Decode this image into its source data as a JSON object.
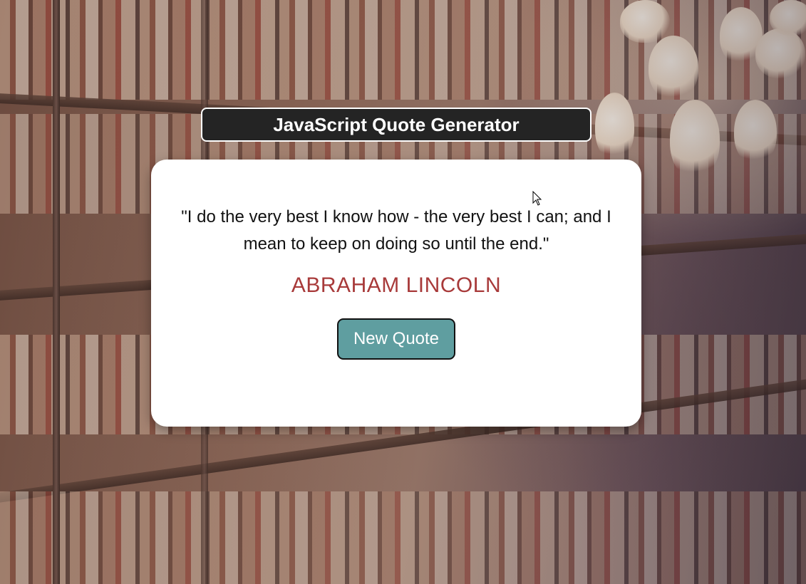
{
  "header": {
    "title": "JavaScript Quote Generator"
  },
  "quote": {
    "text": "\"I do the very best I know how - the very best I can; and I mean to keep on doing so until the end.\"",
    "author": "ABRAHAM LINCOLN"
  },
  "actions": {
    "new_quote_label": "New Quote"
  },
  "colors": {
    "title_background": "#242424",
    "author_text": "#a83a3a",
    "button_background": "#5f9ea0",
    "card_background": "#ffffff"
  },
  "icons": {
    "cursor": "mouse-pointer-icon"
  }
}
